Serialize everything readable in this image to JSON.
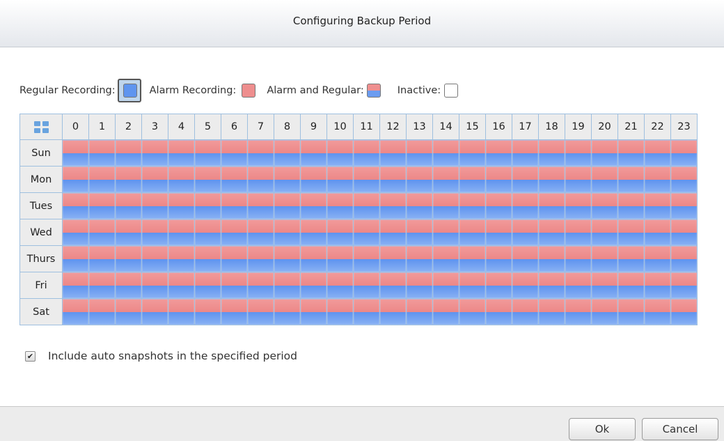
{
  "dialog": {
    "title": "Configuring Backup Period"
  },
  "legend": {
    "regular_label": "Regular Recording:",
    "alarm_label": "Alarm Recording:",
    "both_label": "Alarm and Regular:",
    "inactive_label": "Inactive:",
    "colors": {
      "regular": "#5f95ef",
      "alarm": "#ee8e8e",
      "both_top": "#ef8f8f",
      "both_bottom": "#6b9cf0",
      "inactive": "#ffffff"
    }
  },
  "schedule": {
    "hours": [
      "0",
      "1",
      "2",
      "3",
      "4",
      "5",
      "6",
      "7",
      "8",
      "9",
      "10",
      "11",
      "12",
      "13",
      "14",
      "15",
      "16",
      "17",
      "18",
      "19",
      "20",
      "21",
      "22",
      "23"
    ],
    "days": [
      "Sun",
      "Mon",
      "Tues",
      "Wed",
      "Thurs",
      "Fri",
      "Sat"
    ],
    "cell_state": "alarm-and-regular"
  },
  "options": {
    "snapshot_label": "Include auto snapshots in the specified period",
    "snapshot_checked": true
  },
  "footer": {
    "ok_label": "Ok",
    "cancel_label": "Cancel"
  }
}
